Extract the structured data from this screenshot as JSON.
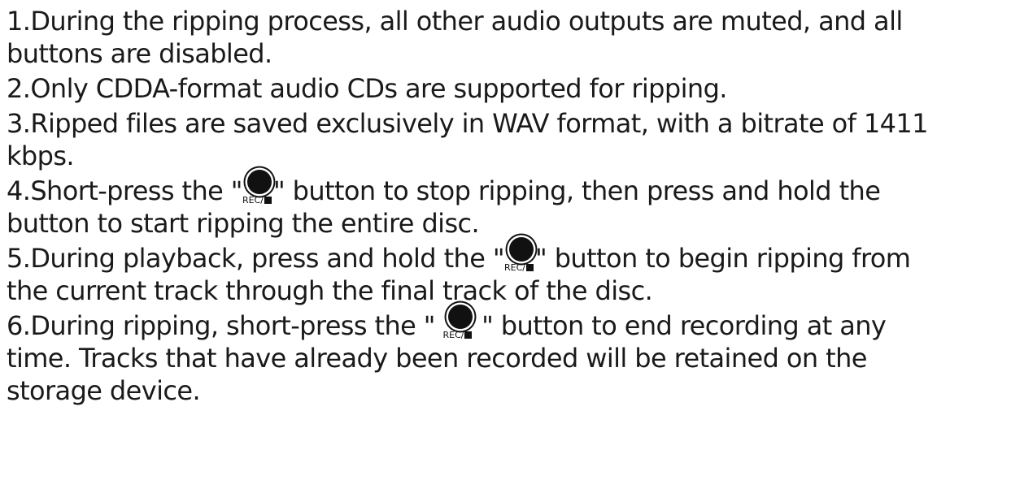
{
  "items": [
    {
      "lines": [
        "1.During the ripping process, all other audio outputs are muted, and all",
        "buttons are disabled."
      ]
    },
    {
      "lines": [
        "2.Only CDDA-format audio CDs are supported for ripping."
      ]
    },
    {
      "lines": [
        "3.Ripped files are saved exclusively in WAV format, with a bitrate of 1411",
        "kbps."
      ]
    },
    {
      "pre": "4.Short-press the \"",
      "post": "\" button to stop ripping, then press and hold the",
      "cont": "button to start ripping the entire disc."
    },
    {
      "pre": "5.During playback, press and hold the \"",
      "post": "\" button to begin ripping from",
      "cont": "the current track through the final track of the disc."
    },
    {
      "pre": "6.During ripping, short-press the \" ",
      "post": " \" button to end recording at any",
      "cont": "time. Tracks that have already been recorded will be retained on the",
      "cont2": "storage device."
    }
  ],
  "rec_button": {
    "label": "REC/",
    "icon": "record-stop-icon"
  }
}
